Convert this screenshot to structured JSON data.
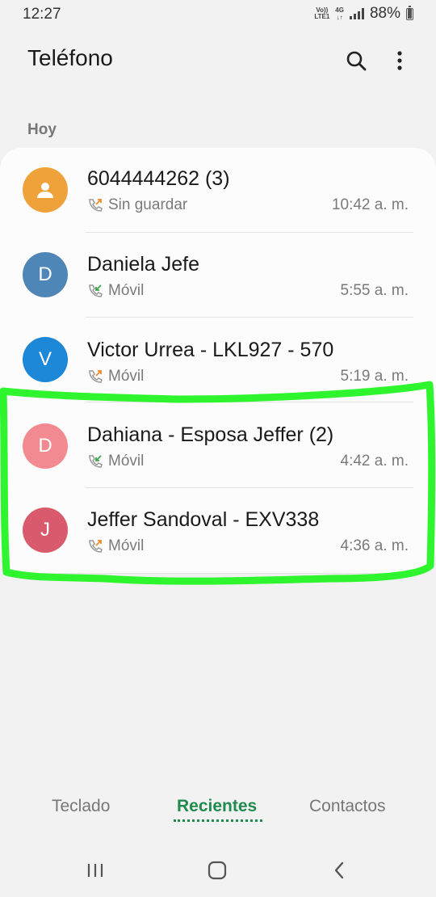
{
  "status_bar": {
    "time": "12:27",
    "volte_line1": "Vo))",
    "volte_line2": "LTE1",
    "network": "4G",
    "battery_percent": "88%"
  },
  "header": {
    "title": "Teléfono",
    "icons": [
      "search-icon",
      "more-vert-icon"
    ]
  },
  "section": {
    "label": "Hoy"
  },
  "calls": [
    {
      "name": "6044444262 (3)",
      "avatar_letter": "",
      "avatar_color": "#f0a23a",
      "call_type": "outgoing",
      "subtitle": "Sin guardar",
      "time": "10:42 a. m."
    },
    {
      "name": "Daniela Jefe",
      "avatar_letter": "D",
      "avatar_color": "#4f86b8",
      "call_type": "incoming",
      "subtitle": "Móvil",
      "time": "5:55 a. m."
    },
    {
      "name": "Victor Urrea - LKL927 - 570",
      "avatar_letter": "V",
      "avatar_color": "#1e88d8",
      "call_type": "outgoing",
      "subtitle": "Móvil",
      "time": "5:19 a. m."
    },
    {
      "name": "Dahiana - Esposa Jeffer (2)",
      "avatar_letter": "D",
      "avatar_color": "#f28a92",
      "call_type": "incoming",
      "subtitle": "Móvil",
      "time": "4:42 a. m."
    },
    {
      "name": "Jeffer Sandoval - EXV338",
      "avatar_letter": "J",
      "avatar_color": "#d95a6c",
      "call_type": "outgoing",
      "subtitle": "Móvil",
      "time": "4:36 a. m."
    }
  ],
  "tabs": [
    {
      "label": "Teclado",
      "active": false
    },
    {
      "label": "Recientes",
      "active": true
    },
    {
      "label": "Contactos",
      "active": false
    }
  ],
  "colors": {
    "accent": "#1f8b4c",
    "highlight_marker": "#2ef52e",
    "outgoing_arrow": "#f28a2e",
    "incoming_arrow": "#3aa84a"
  },
  "nav_bar": [
    "recent-apps-icon",
    "home-icon",
    "back-icon"
  ]
}
